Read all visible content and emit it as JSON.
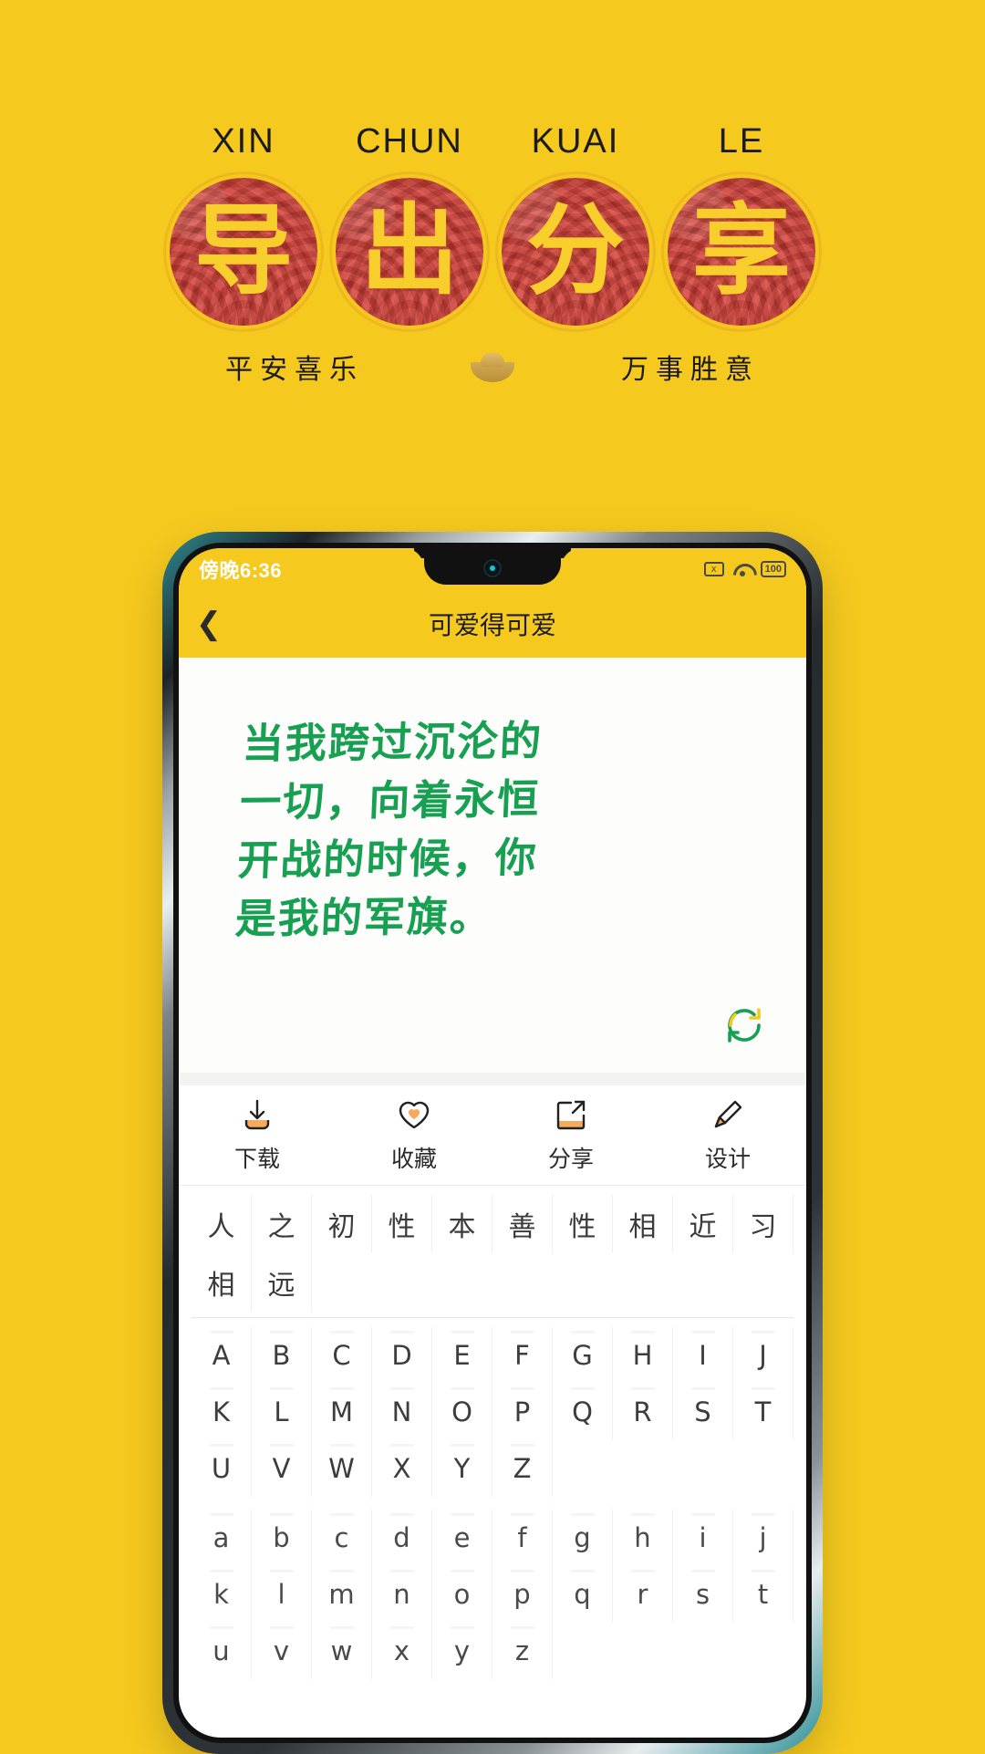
{
  "poster": {
    "background_color": "#F5C91E",
    "pinyin": [
      "XIN",
      "CHUN",
      "KUAI",
      "LE"
    ],
    "seals": [
      {
        "char": "导",
        "color": "#cf3d35",
        "text_color": "#F7CE2C"
      },
      {
        "char": "出",
        "color": "#cf3d35",
        "text_color": "#F7CE2C"
      },
      {
        "char": "分",
        "color": "#cf3d35",
        "text_color": "#F7CE2C"
      },
      {
        "char": "享",
        "color": "#cf3d35",
        "text_color": "#F7CE2C"
      }
    ],
    "blessing_left": "平安喜乐",
    "blessing_right": "万事胜意",
    "ingot_icon": "gold-ingot-icon"
  },
  "phone": {
    "statusbar": {
      "time": "傍晚6:36",
      "icons": [
        "no-sim-icon",
        "wifi-icon",
        "battery-icon"
      ],
      "battery_level": "100"
    },
    "header": {
      "back_icon": "chevron-left-icon",
      "title": "可爱得可爱"
    },
    "card": {
      "quote_lines": [
        "当我跨过沉沦的",
        "一切，向着永恒",
        "开战的时候，你",
        "是我的军旗。"
      ],
      "text_color": "#17a052",
      "refresh_icon": "refresh-icon"
    },
    "actions": [
      {
        "icon": "download-icon",
        "label": "下载"
      },
      {
        "icon": "heart-icon",
        "label": "收藏"
      },
      {
        "icon": "share-icon",
        "label": "分享"
      },
      {
        "icon": "pencil-icon",
        "label": "设计"
      }
    ],
    "keyboard": {
      "hanzi_rows": [
        [
          "人",
          "之",
          "初",
          "性",
          "本",
          "善",
          "性",
          "相",
          "近",
          "习"
        ],
        [
          "相",
          "远"
        ]
      ],
      "alpha_rows": [
        [
          "A",
          "B",
          "C",
          "D",
          "E",
          "F",
          "G",
          "H",
          "I",
          "J"
        ],
        [
          "K",
          "L",
          "M",
          "N",
          "O",
          "P",
          "Q",
          "R",
          "S",
          "T"
        ],
        [
          "U",
          "V",
          "W",
          "X",
          "Y",
          "Z"
        ],
        [
          "a",
          "b",
          "c",
          "d",
          "e",
          "f",
          "g",
          "h",
          "i",
          "j"
        ],
        [
          "k",
          "l",
          "m",
          "n",
          "o",
          "p",
          "q",
          "r",
          "s",
          "t"
        ],
        [
          "u",
          "v",
          "w",
          "x",
          "y",
          "z"
        ]
      ]
    }
  }
}
